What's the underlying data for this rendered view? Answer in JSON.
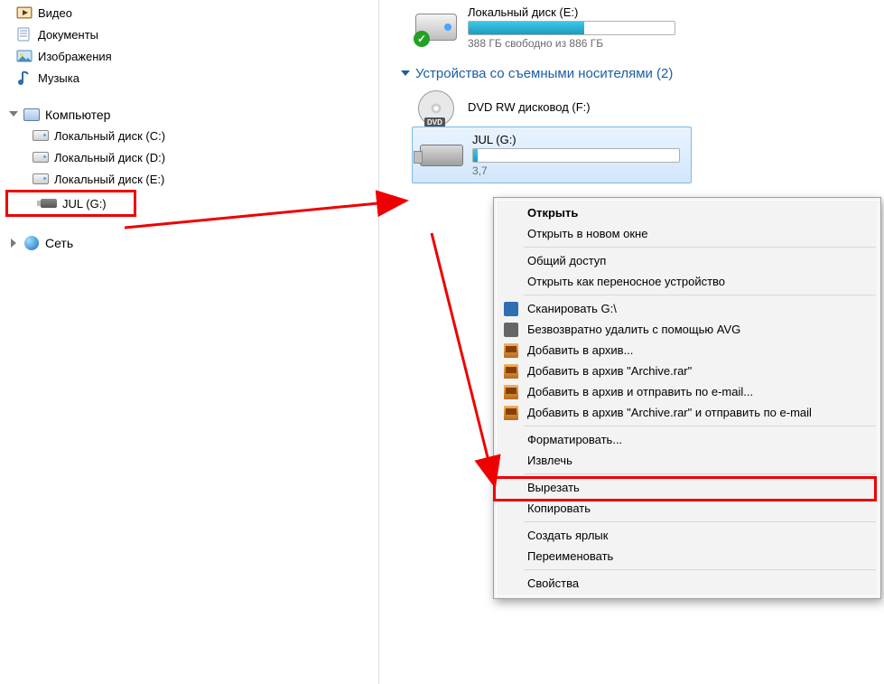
{
  "nav": {
    "libraries": [
      {
        "label": "Видео",
        "icon": "video"
      },
      {
        "label": "Документы",
        "icon": "docs"
      },
      {
        "label": "Изображения",
        "icon": "pictures"
      },
      {
        "label": "Музыка",
        "icon": "music"
      }
    ],
    "computer": {
      "header": "Компьютер",
      "drives": [
        {
          "label": "Локальный диск (C:)"
        },
        {
          "label": "Локальный диск (D:)"
        },
        {
          "label": "Локальный диск (E:)"
        },
        {
          "label": "JUL (G:)",
          "highlighted": true,
          "type": "usb"
        }
      ]
    },
    "network": {
      "header": "Сеть"
    }
  },
  "details": {
    "localE": {
      "name": "Локальный диск (E:)",
      "sub": "388 ГБ свободно из 886 ГБ",
      "fillPct": 56
    },
    "removableHeader": "Устройства со съемными носителями (2)",
    "dvd": {
      "name": "DVD RW дисковод (F:)"
    },
    "usb": {
      "name": "JUL (G:)",
      "subPartial": "3,7",
      "fillPct": 2
    }
  },
  "menu": {
    "open": "Открыть",
    "openNew": "Открыть в новом окне",
    "share": "Общий доступ",
    "portable": "Открыть как переносное устройство",
    "scan": "Сканировать G:\\",
    "shred": "Безвозвратно удалить с помощью AVG",
    "rarAdd": "Добавить в архив...",
    "rarAddName": "Добавить в архив \"Archive.rar\"",
    "rarEmail": "Добавить в архив и отправить по e-mail...",
    "rarNameEmail": "Добавить в архив \"Archive.rar\" и отправить по e-mail",
    "format": "Форматировать...",
    "eject": "Извлечь",
    "cut": "Вырезать",
    "copy": "Копировать",
    "shortcut": "Создать ярлык",
    "rename": "Переименовать",
    "props": "Свойства"
  }
}
